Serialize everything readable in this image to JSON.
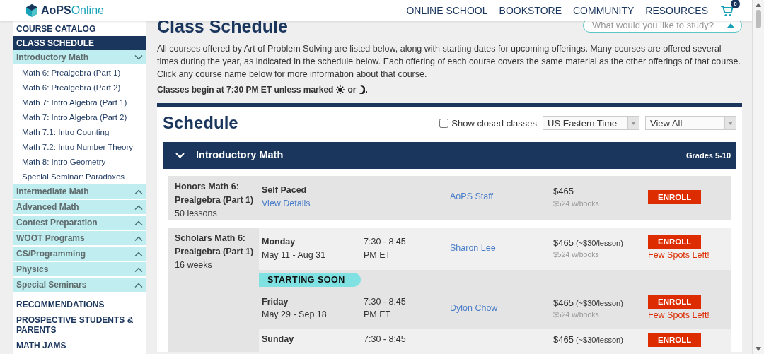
{
  "header": {
    "logo_bold": "AoPS",
    "logo_light": "Online",
    "nav": [
      "ONLINE SCHOOL",
      "BOOKSTORE",
      "COMMUNITY",
      "RESOURCES"
    ],
    "cart_count": "0"
  },
  "sidebar": {
    "top_links": [
      {
        "label": "COURSE CATALOG",
        "selected": false
      },
      {
        "label": "CLASS SCHEDULE",
        "selected": true
      }
    ],
    "categories": [
      {
        "label": "Introductory Math",
        "expanded": true,
        "children": [
          "Math 6: Prealgebra (Part 1)",
          "Math 6: Prealgebra (Part 2)",
          "Math 7: Intro Algebra (Part 1)",
          "Math 7: Intro Algebra (Part 2)",
          "Math 7.1: Intro Counting",
          "Math 7.2: Intro Number Theory",
          "Math 8: Intro Geometry",
          "Special Seminar: Paradoxes"
        ]
      },
      {
        "label": "Intermediate Math",
        "expanded": false
      },
      {
        "label": "Advanced Math",
        "expanded": false
      },
      {
        "label": "Contest Preparation",
        "expanded": false
      },
      {
        "label": "WOOT Programs",
        "expanded": false
      },
      {
        "label": "CS/Programming",
        "expanded": false
      },
      {
        "label": "Physics",
        "expanded": false
      },
      {
        "label": "Special Seminars",
        "expanded": false
      }
    ],
    "bottom_links": [
      "RECOMMENDATIONS",
      "PROSPECTIVE STUDENTS & PARENTS",
      "MATH JAMS"
    ]
  },
  "page": {
    "title": "Class Schedule",
    "search": {
      "placeholder": "What would you like to study?"
    },
    "intro": "All courses offered by Art of Problem Solving are listed below, along with starting dates for upcoming offerings. Many courses are offered several times during the year, as indicated in the schedule below. Each offering of each course covers the same material as the other offerings of that course. Click any course name below for more information about that course.",
    "note_before": "Classes begin at 7:30 PM ET unless marked",
    "note_or": "or",
    "note_end": "."
  },
  "schedule": {
    "title": "Schedule",
    "show_closed": {
      "label": "Show closed classes",
      "checked": false
    },
    "timezone": "US Eastern Time",
    "view": "View All",
    "category": {
      "title": "Introductory Math",
      "grades": "Grades 5-10",
      "expanded": true
    },
    "courses": [
      {
        "name": "Honors Math 6: Prealgebra (Part 1)",
        "length": "50 lessons",
        "sessions": [
          {
            "kind": "self-paced",
            "day": "Self Paced",
            "link": "View Details",
            "instructor": "AoPS Staff",
            "price": "$465",
            "books": "$524 w/books",
            "enroll": "ENROLL"
          }
        ]
      },
      {
        "name": "Scholars Math 6: Prealgebra (Part 1)",
        "length": "16 weeks",
        "sessions": [
          {
            "kind": "weekly",
            "day": "Monday",
            "dates": "May 11 - Aug 31",
            "time": "7:30 - 8:45 PM ET",
            "instructor": "Sharon Lee",
            "price": "$465",
            "per_lesson": "(~$30/lesson)",
            "books": "$524 w/books",
            "enroll": "ENROLL",
            "flag": "Few Spots Left!"
          },
          {
            "kind": "weekly",
            "badge": "STARTING SOON",
            "day": "Friday",
            "dates": "May 29 - Sep 18",
            "time": "7:30 - 8:45 PM ET",
            "instructor": "Dylon Chow",
            "price": "$465",
            "per_lesson": "(~$30/lesson)",
            "books": "$524 w/books",
            "enroll": "ENROLL",
            "flag": "Few Spots Left!"
          },
          {
            "kind": "weekly",
            "day": "Sunday",
            "time": "7:30 - 8:45",
            "price": "$465",
            "per_lesson": "(~$30/lesson)",
            "enroll": "ENROLL"
          }
        ]
      }
    ]
  }
}
